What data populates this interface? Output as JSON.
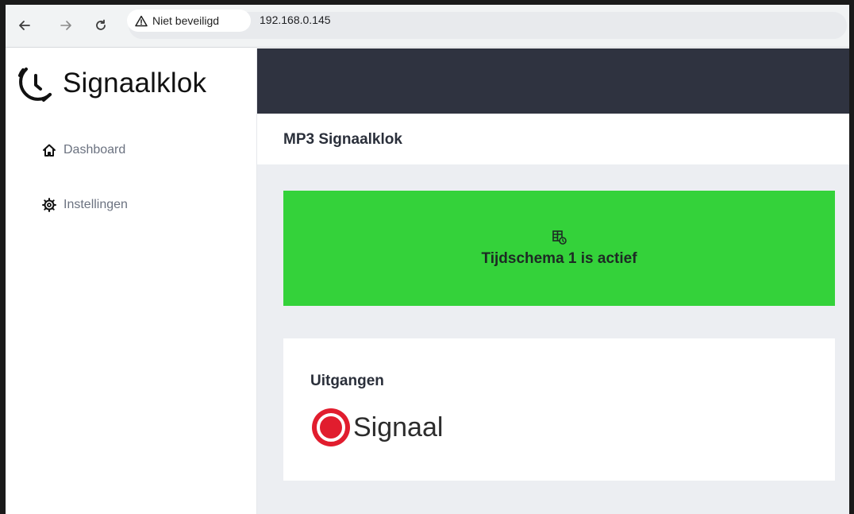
{
  "browser": {
    "security_label": "Niet beveiligd",
    "url": "192.168.0.145"
  },
  "sidebar": {
    "brand": "Signaalklok",
    "items": [
      {
        "label": "Dashboard",
        "icon": "home-icon"
      },
      {
        "label": "Instellingen",
        "icon": "gear-icon"
      }
    ]
  },
  "header": {
    "title": "MP3 Signaalklok"
  },
  "status": {
    "text": "Tijdschema 1 is actief",
    "icon": "schedule-icon",
    "color": "#34d23a"
  },
  "outputs": {
    "title": "Uitgangen",
    "items": [
      {
        "label": "Signaal",
        "state_color": "#e11d2e"
      }
    ]
  },
  "colors": {
    "topbar": "#2f3340",
    "background": "#eceef2"
  }
}
